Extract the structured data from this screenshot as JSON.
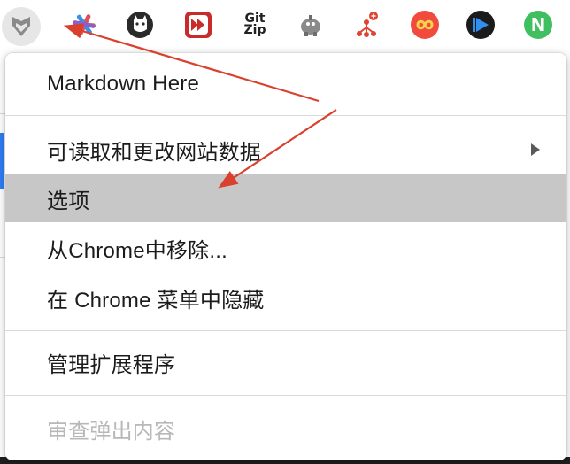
{
  "toolbar": {
    "extensions": [
      {
        "icon": "markdown-here-icon"
      },
      {
        "icon": "star-pinwheel-icon"
      },
      {
        "icon": "cat-head-icon"
      },
      {
        "icon": "fast-forward-icon"
      },
      {
        "icon": "git-zip-icon",
        "line1": "Git",
        "line2": "Zip"
      },
      {
        "icon": "robot-elephant-icon"
      },
      {
        "icon": "network-tree-icon"
      },
      {
        "icon": "infinity-icon"
      },
      {
        "icon": "play-circle-icon"
      },
      {
        "icon": "n-logo-icon",
        "letter": "N"
      }
    ]
  },
  "menu": {
    "items": [
      {
        "label": "Markdown Here"
      },
      {
        "label": "可读取和更改网站数据"
      },
      {
        "label": "选项"
      },
      {
        "label": "从Chrome中移除..."
      },
      {
        "label": "在 Chrome 菜单中隐藏"
      },
      {
        "label": "管理扩展程序"
      },
      {
        "label": "审查弹出内容"
      }
    ]
  },
  "colors": {
    "highlight": "#c7c7c7",
    "disabled_text": "#b8b8b8",
    "annotation_arrow": "#d9412e"
  }
}
